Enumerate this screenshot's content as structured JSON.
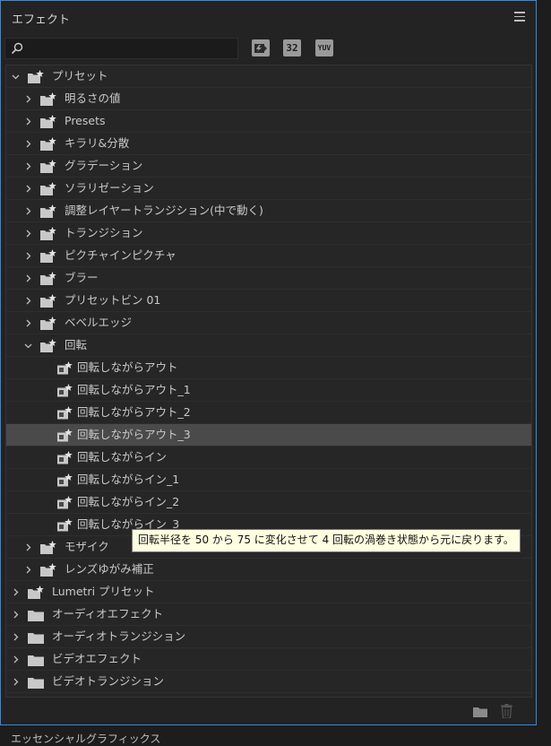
{
  "panel": {
    "title": "エフェクト"
  },
  "search": {
    "placeholder": "",
    "value": ""
  },
  "toolbar": {
    "accelerated_icon": "accelerated-effects-icon",
    "bit32_label": "32",
    "yuv_label": "YUV"
  },
  "tree": [
    {
      "label": "プリセット",
      "level": 0,
      "expanded": true,
      "icon": "preset-folder-icon"
    },
    {
      "label": "明るさの値",
      "level": 1,
      "expanded": false,
      "icon": "preset-folder-icon"
    },
    {
      "label": "Presets",
      "level": 1,
      "expanded": false,
      "icon": "preset-folder-icon"
    },
    {
      "label": "キラリ&分散",
      "level": 1,
      "expanded": false,
      "icon": "preset-folder-icon"
    },
    {
      "label": "グラデーション",
      "level": 1,
      "expanded": false,
      "icon": "preset-folder-icon"
    },
    {
      "label": "ソラリゼーション",
      "level": 1,
      "expanded": false,
      "icon": "preset-folder-icon"
    },
    {
      "label": "調整レイヤートランジション(中で動く)",
      "level": 1,
      "expanded": false,
      "icon": "preset-folder-icon"
    },
    {
      "label": "トランジション",
      "level": 1,
      "expanded": false,
      "icon": "preset-folder-icon"
    },
    {
      "label": "ピクチャインピクチャ",
      "level": 1,
      "expanded": false,
      "icon": "preset-folder-icon"
    },
    {
      "label": "ブラー",
      "level": 1,
      "expanded": false,
      "icon": "preset-folder-icon"
    },
    {
      "label": "プリセットビン 01",
      "level": 1,
      "expanded": false,
      "icon": "preset-folder-icon"
    },
    {
      "label": "ベベルエッジ",
      "level": 1,
      "expanded": false,
      "icon": "preset-folder-icon"
    },
    {
      "label": "回転",
      "level": 1,
      "expanded": true,
      "icon": "preset-folder-icon"
    },
    {
      "label": "回転しながらアウト",
      "level": 2,
      "icon": "preset-item-icon"
    },
    {
      "label": "回転しながらアウト_1",
      "level": 2,
      "icon": "preset-item-icon"
    },
    {
      "label": "回転しながらアウト_2",
      "level": 2,
      "icon": "preset-item-icon"
    },
    {
      "label": "回転しながらアウト_3",
      "level": 2,
      "icon": "preset-item-icon",
      "selected": true
    },
    {
      "label": "回転しながらイン",
      "level": 2,
      "icon": "preset-item-icon"
    },
    {
      "label": "回転しながらイン_1",
      "level": 2,
      "icon": "preset-item-icon"
    },
    {
      "label": "回転しながらイン_2",
      "level": 2,
      "icon": "preset-item-icon"
    },
    {
      "label": "回転しながらイン_3",
      "level": 2,
      "icon": "preset-item-icon"
    },
    {
      "label": "モザイク",
      "level": 1,
      "expanded": false,
      "icon": "preset-folder-icon"
    },
    {
      "label": "レンズゆがみ補正",
      "level": 1,
      "expanded": false,
      "icon": "preset-folder-icon"
    },
    {
      "label": "Lumetri プリセット",
      "level": 0,
      "expanded": false,
      "icon": "preset-folder-icon"
    },
    {
      "label": "オーディオエフェクト",
      "level": 0,
      "expanded": false,
      "icon": "folder-icon"
    },
    {
      "label": "オーディオトランジション",
      "level": 0,
      "expanded": false,
      "icon": "folder-icon"
    },
    {
      "label": "ビデオエフェクト",
      "level": 0,
      "expanded": false,
      "icon": "folder-icon"
    },
    {
      "label": "ビデオトランジション",
      "level": 0,
      "expanded": false,
      "icon": "folder-icon"
    }
  ],
  "tooltip": {
    "text": "回転半径を 50 から 75 に変化させて 4 回転の渦巻き状態から元に戻ります。"
  },
  "footer": {
    "new_bin_icon": "new-bin-icon",
    "delete_icon": "trash-icon"
  },
  "bottom_panel": {
    "title": "エッセンシャルグラフィックス"
  },
  "colors": {
    "accent_border": "#2d8ceb",
    "selected_row": "#4a4a4a",
    "tooltip_bg": "#ffffe1"
  }
}
